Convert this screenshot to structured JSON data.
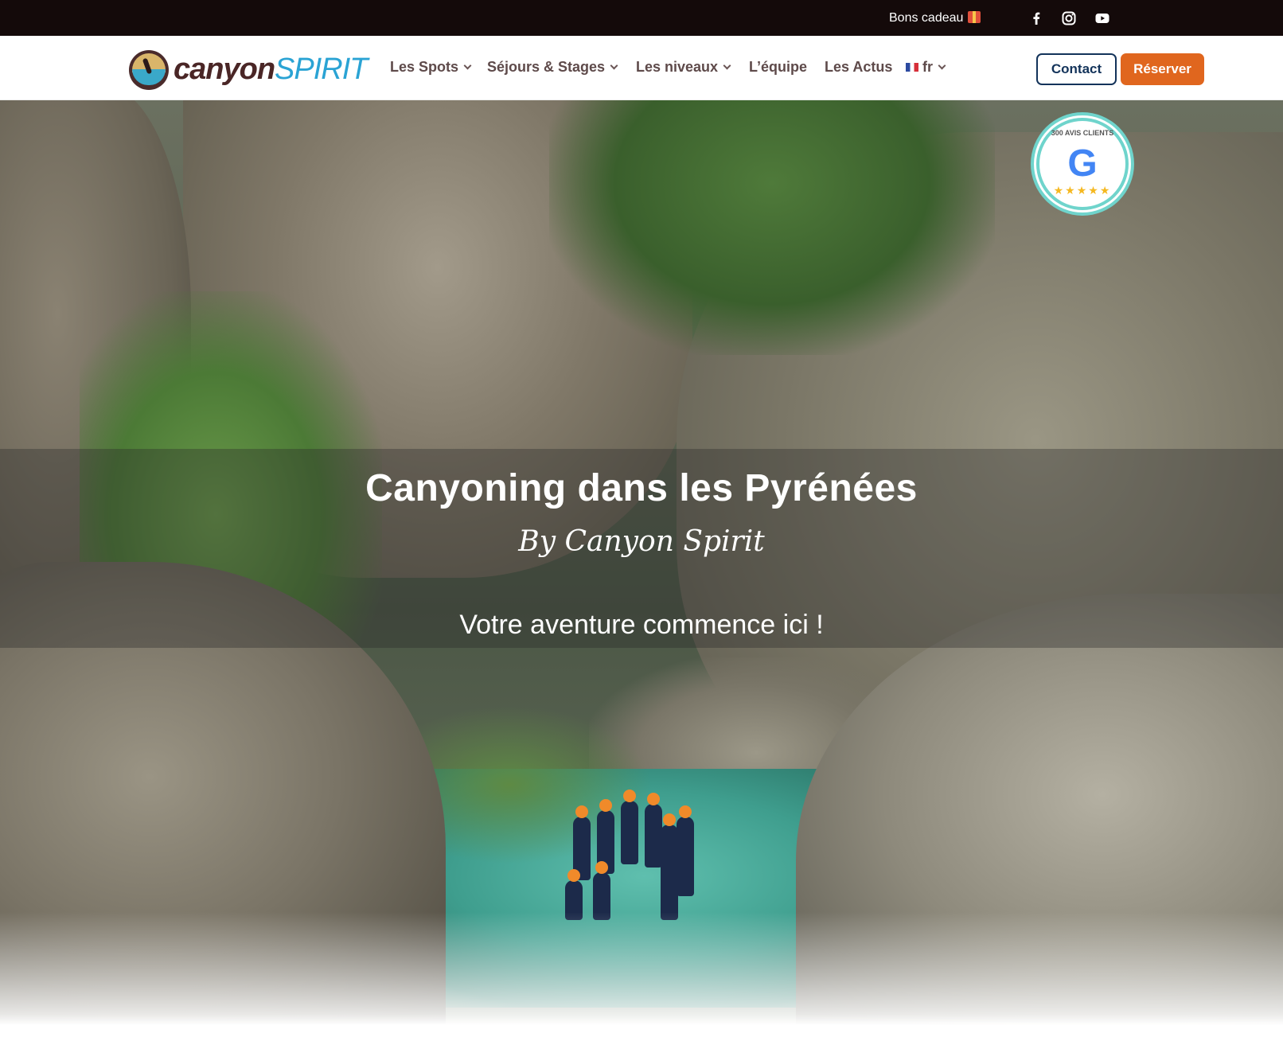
{
  "topbar": {
    "gift_label": "Bons cadeau",
    "gift_icon": "gift-emoji",
    "social": [
      {
        "name": "facebook-icon"
      },
      {
        "name": "instagram-icon"
      },
      {
        "name": "youtube-icon"
      }
    ]
  },
  "header": {
    "logo": {
      "part1": "canyon",
      "part2": "SPIRIT"
    },
    "nav": [
      {
        "label": "Les Spots",
        "has_dropdown": true
      },
      {
        "label": "Séjours & Stages",
        "has_dropdown": true
      },
      {
        "label": "Les niveaux",
        "has_dropdown": true
      },
      {
        "label": "L’équipe",
        "has_dropdown": false
      },
      {
        "label": "Les Actus",
        "has_dropdown": false
      },
      {
        "label": "fr",
        "has_dropdown": true,
        "flag": "fr-flag-icon"
      }
    ],
    "contact_label": "Contact",
    "reserve_label": "Réserver"
  },
  "hero": {
    "title": "Canyoning dans les Pyrénées",
    "subtitle": "By Canyon Spirit",
    "tagline": "Votre aventure commence ici !",
    "badge": {
      "ring_text": "300 AVIS CLIENTS",
      "logo": "G",
      "stars": "★★★★★"
    }
  },
  "colors": {
    "topbar_bg": "#140a0a",
    "brand_dark": "#4a2626",
    "brand_blue": "#2aa3d4",
    "contact_border": "#13335a",
    "reserve_bg": "#e0661e",
    "badge_ring": "#6fd4cc"
  }
}
